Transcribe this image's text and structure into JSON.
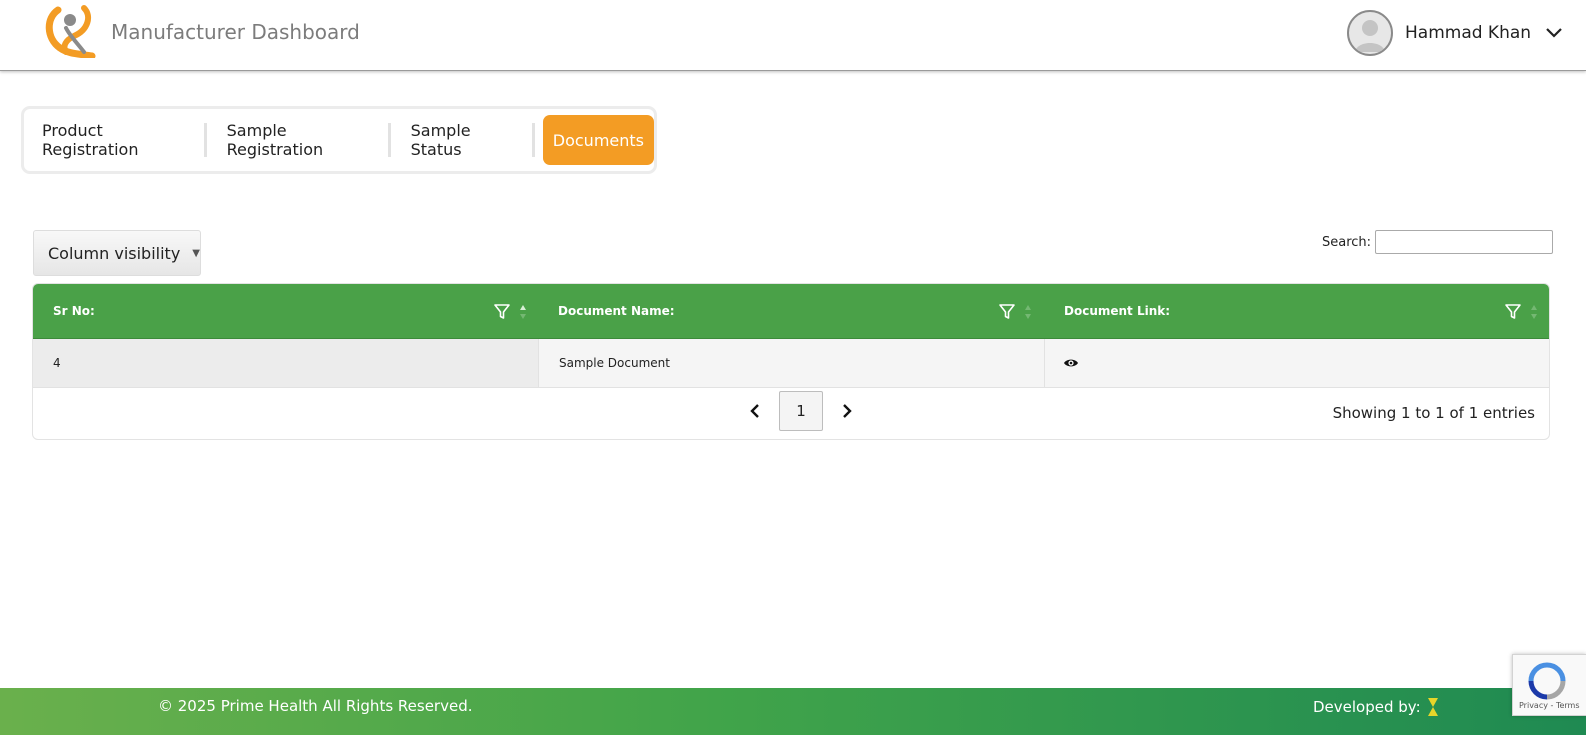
{
  "header": {
    "title": "Manufacturer Dashboard",
    "user_name": "Hammad Khan"
  },
  "tabs": [
    {
      "label": "Product Registration",
      "active": false
    },
    {
      "label": "Sample Registration",
      "active": false
    },
    {
      "label": "Sample Status",
      "active": false
    },
    {
      "label": "Documents",
      "active": true
    }
  ],
  "controls": {
    "column_visibility": "Column visibility",
    "search_label": "Search:",
    "search_value": ""
  },
  "table": {
    "columns": [
      "Sr No:",
      "Document Name:",
      "Document Link:"
    ],
    "rows": [
      {
        "sr_no": "4",
        "document_name": "Sample Document",
        "document_link": "eye-icon"
      }
    ]
  },
  "pagination": {
    "current_page": "1",
    "info": "Showing 1 to 1 of 1 entries"
  },
  "footer": {
    "copyright": "© 2025 Prime Health All Rights Reserved.",
    "developed_by": "Developed by:"
  },
  "recaptcha": {
    "terms": "Privacy - Terms"
  },
  "colors": {
    "accent_orange": "#f39c24",
    "table_header_green": "#4aa148",
    "footer_green": "#41a44a"
  }
}
